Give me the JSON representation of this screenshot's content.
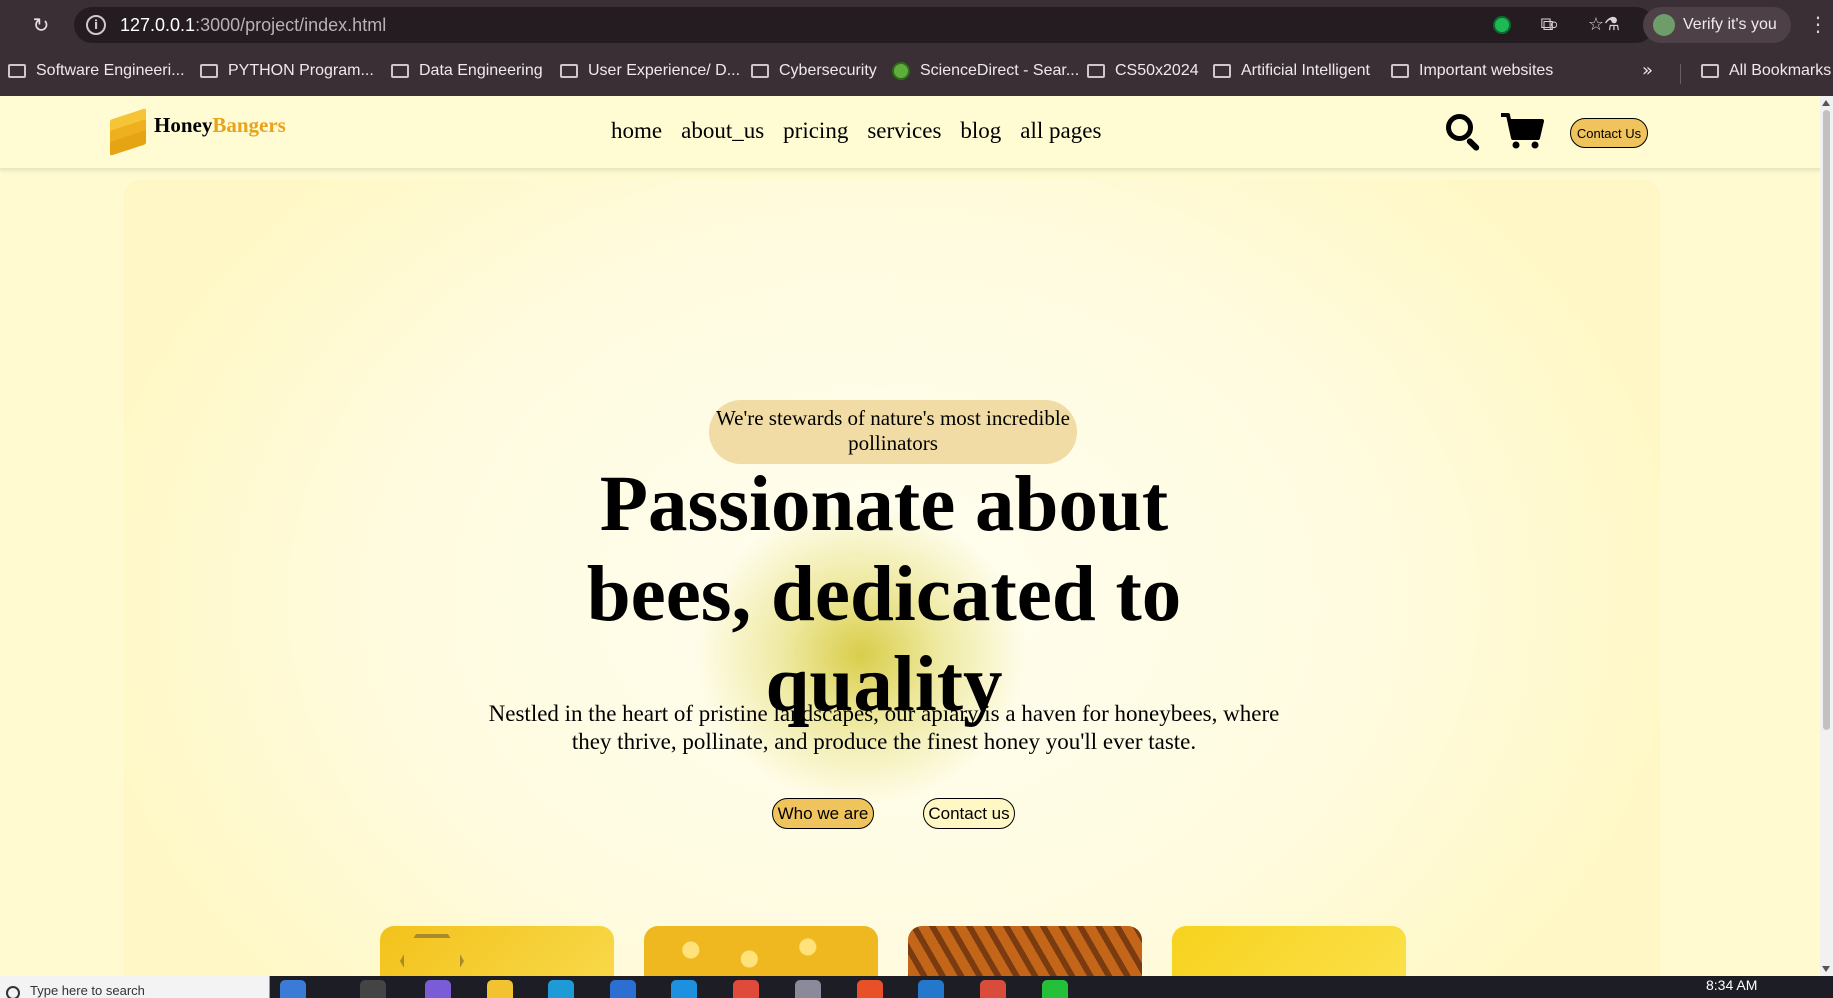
{
  "browser": {
    "url_host": "127.0.0.1",
    "url_path": ":3000/project/index.html",
    "profile_label": "Verify it's you",
    "bookmarks": [
      {
        "label": "Software Engineeri...",
        "icon": "folder-icon"
      },
      {
        "label": "PYTHON Program...",
        "icon": "folder-icon"
      },
      {
        "label": "Data Engineering",
        "icon": "folder-icon"
      },
      {
        "label": "User Experience/ D...",
        "icon": "folder-icon"
      },
      {
        "label": "Cybersecurity",
        "icon": "folder-icon"
      },
      {
        "label": "ScienceDirect - Sear...",
        "icon": "globe-icon"
      },
      {
        "label": "CS50x2024",
        "icon": "folder-icon"
      },
      {
        "label": "Artificial Intelligent",
        "icon": "folder-icon"
      },
      {
        "label": "Important websites",
        "icon": "folder-icon"
      },
      {
        "label": "All Bookmarks",
        "icon": "folder-icon"
      }
    ],
    "more_label": "»"
  },
  "site": {
    "logo": {
      "part1": "Honey",
      "part2": "Bangers"
    },
    "nav": [
      "home",
      "about_us",
      "pricing",
      "services",
      "blog",
      "all pages"
    ],
    "contact_button": "Contact Us"
  },
  "hero": {
    "pill": "We're stewards of nature's most incredible pollinators",
    "headline": "Passionate about bees, dedicated to quality",
    "subtext": "Nestled in the heart of pristine landscapes, our apiary is a haven for honeybees, where they thrive, pollinate, and produce the finest honey you'll ever taste.",
    "primary_button": "Who we are",
    "secondary_button": "Contact us"
  },
  "taskbar": {
    "search_placeholder": "Type here to search",
    "time": "8:34 AM"
  },
  "colors": {
    "accent": "#f0c45c",
    "brand": "#e8a31e",
    "page_bg": "#fffad0",
    "chrome": "#3b2f36"
  }
}
